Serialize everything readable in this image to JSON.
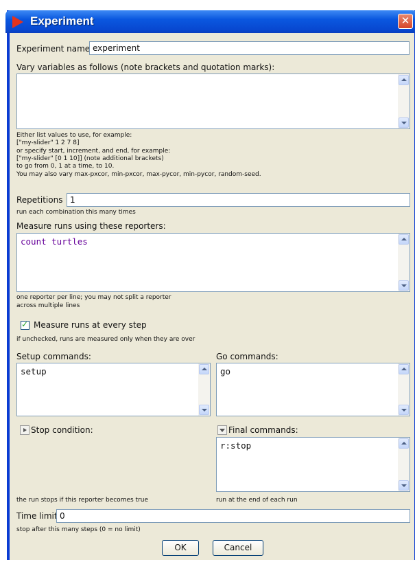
{
  "window": {
    "title": "Experiment",
    "close_glyph": "✕",
    "icon": "netlogo-red-arrow-icon",
    "title_color": "#0a57df"
  },
  "experiment_name": {
    "label": "Experiment name",
    "value": "experiment"
  },
  "vary": {
    "label": "Vary variables as follows (note brackets and quotation marks):",
    "value": "",
    "help": [
      "Either list values to use, for example:",
      "[\"my-slider\" 1 2 7 8]",
      "or specify start, increment, and end, for example:",
      "[\"my-slider\" [0 1 10]] (note additional brackets)",
      "to go from 0, 1 at a time, to 10.",
      "You may also vary max-pxcor, min-pxcor, max-pycor, min-pycor, random-seed."
    ]
  },
  "repetitions": {
    "label": "Repetitions",
    "value": "1",
    "help": "run each combination this many times"
  },
  "reporters": {
    "label": "Measure runs using these reporters:",
    "value": "count turtles",
    "value_color": "#660099",
    "help": [
      "one reporter per line; you may not split a reporter",
      "across multiple lines"
    ]
  },
  "measure_every_step": {
    "label": "Measure runs at every step",
    "checked": true,
    "help": "if unchecked, runs are measured only when they are over"
  },
  "setup": {
    "label": "Setup commands:",
    "value": "setup"
  },
  "go": {
    "label": "Go commands:",
    "value": "go"
  },
  "stop_condition": {
    "label": "Stop condition:",
    "help": "the run stops if this reporter becomes true"
  },
  "final_commands": {
    "label": "Final commands:",
    "value": "r:stop",
    "help": "run at the end of each run"
  },
  "time_limit": {
    "label": "Time limit",
    "value": "0",
    "help": "stop after this many steps (0 = no limit)"
  },
  "buttons": {
    "ok": "OK",
    "cancel": "Cancel"
  }
}
